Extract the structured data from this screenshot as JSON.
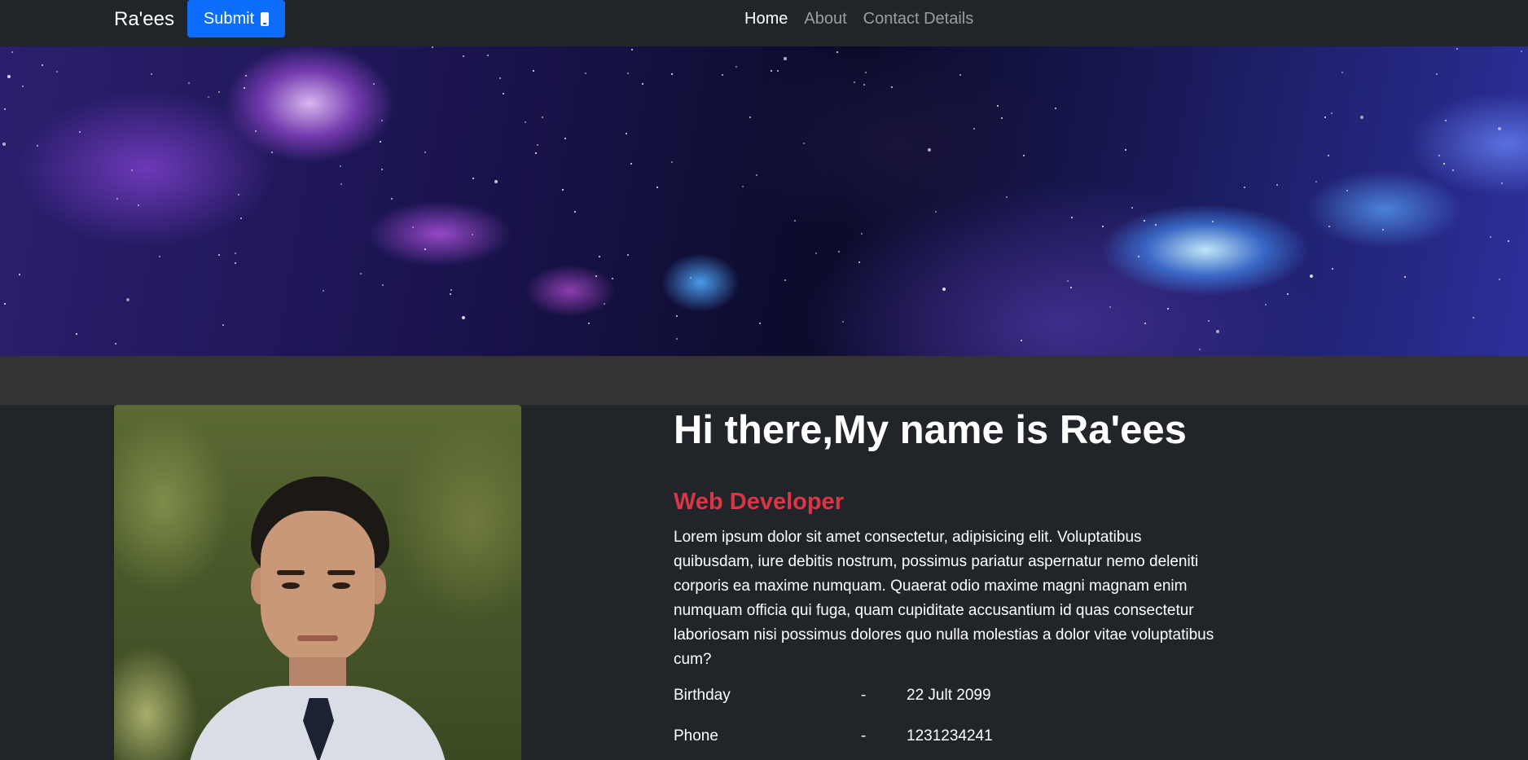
{
  "navbar": {
    "brand": "Ra'ees",
    "submit_label": "Submit",
    "submit_icon": "phone-icon",
    "links": [
      {
        "label": "Home",
        "active": true
      },
      {
        "label": "About",
        "active": false
      },
      {
        "label": "Contact Details",
        "active": false
      }
    ]
  },
  "profile": {
    "headline": "Hi there,My name is Ra'ees",
    "role": "Web Developer",
    "bio": "Lorem ipsum dolor sit amet consectetur, adipisicing elit. Voluptatibus quibusdam, iure debitis nostrum, possimus pariatur aspernatur nemo deleniti corporis ea maxime numquam. Quaerat odio maxime magni magnam enim numquam officia qui fuga, quam cupiditate accusantium id quas consectetur laboriosam nisi possimus dolores quo nulla molestias a dolor vitae voluptatibus cum?",
    "details": [
      {
        "label": "Birthday",
        "separator": "-",
        "value": "22 Jult 2099"
      },
      {
        "label": "Phone",
        "separator": "-",
        "value": "1231234241"
      }
    ]
  },
  "colors": {
    "background": "#212529",
    "band": "#343233",
    "primary": "#0d6efd",
    "accent": "#dc3545"
  }
}
